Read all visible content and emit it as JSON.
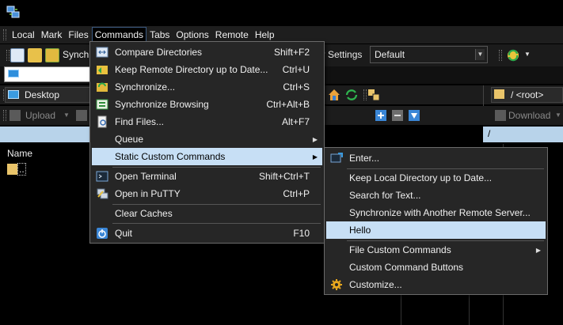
{
  "menubar": {
    "items": [
      "Local",
      "Mark",
      "Files",
      "Commands",
      "Tabs",
      "Options",
      "Remote",
      "Help"
    ]
  },
  "toolbar": {
    "synchronize_partial": "Synch",
    "transfer_settings_partial": "er Settings",
    "transfer_settings_value": "Default"
  },
  "local": {
    "path": "Desktop",
    "upload_label": "Upload",
    "column_name": "Name",
    "parent_dir_label": ".."
  },
  "remote": {
    "path": "/ <root>",
    "download_label": "Download",
    "current_dir": "/"
  },
  "commands_menu": {
    "items": [
      {
        "label": "Compare Directories",
        "shortcut": "Shift+F2",
        "icon": "compare-icon"
      },
      {
        "label": "Keep Remote Directory up to Date...",
        "shortcut": "Ctrl+U",
        "icon": "keep-remote-up-to-date-icon"
      },
      {
        "label": "Synchronize...",
        "shortcut": "Ctrl+S",
        "icon": "synchronize-icon"
      },
      {
        "label": "Synchronize Browsing",
        "shortcut": "Ctrl+Alt+B",
        "icon": "synchronize-browsing-icon"
      },
      {
        "label": "Find Files...",
        "shortcut": "Alt+F7",
        "icon": "find-files-icon"
      },
      {
        "label": "Queue",
        "shortcut": "",
        "icon": ""
      },
      {
        "label": "Static Custom Commands",
        "shortcut": "",
        "icon": ""
      },
      {
        "label": "Open Terminal",
        "shortcut": "Shift+Ctrl+T",
        "icon": "terminal-icon"
      },
      {
        "label": "Open in PuTTY",
        "shortcut": "Ctrl+P",
        "icon": "putty-icon"
      },
      {
        "label": "Clear Caches",
        "shortcut": "",
        "icon": ""
      },
      {
        "label": "Quit",
        "shortcut": "F10",
        "icon": "quit-icon"
      }
    ]
  },
  "custom_commands_submenu": {
    "items": [
      {
        "label": "Enter...",
        "icon": "enter-command-icon"
      },
      {
        "label": "Keep Local Directory up to Date...",
        "icon": ""
      },
      {
        "label": "Search for Text...",
        "icon": ""
      },
      {
        "label": "Synchronize with Another Remote Server...",
        "icon": ""
      },
      {
        "label": "Hello",
        "icon": ""
      },
      {
        "label": "File Custom Commands",
        "icon": ""
      },
      {
        "label": "Custom Command Buttons",
        "icon": ""
      },
      {
        "label": "Customize...",
        "icon": "gear-icon"
      }
    ]
  },
  "colors": {
    "highlight": "#c7dff5",
    "menu_bg": "#262626",
    "header_strip": "#b8d3ea"
  }
}
